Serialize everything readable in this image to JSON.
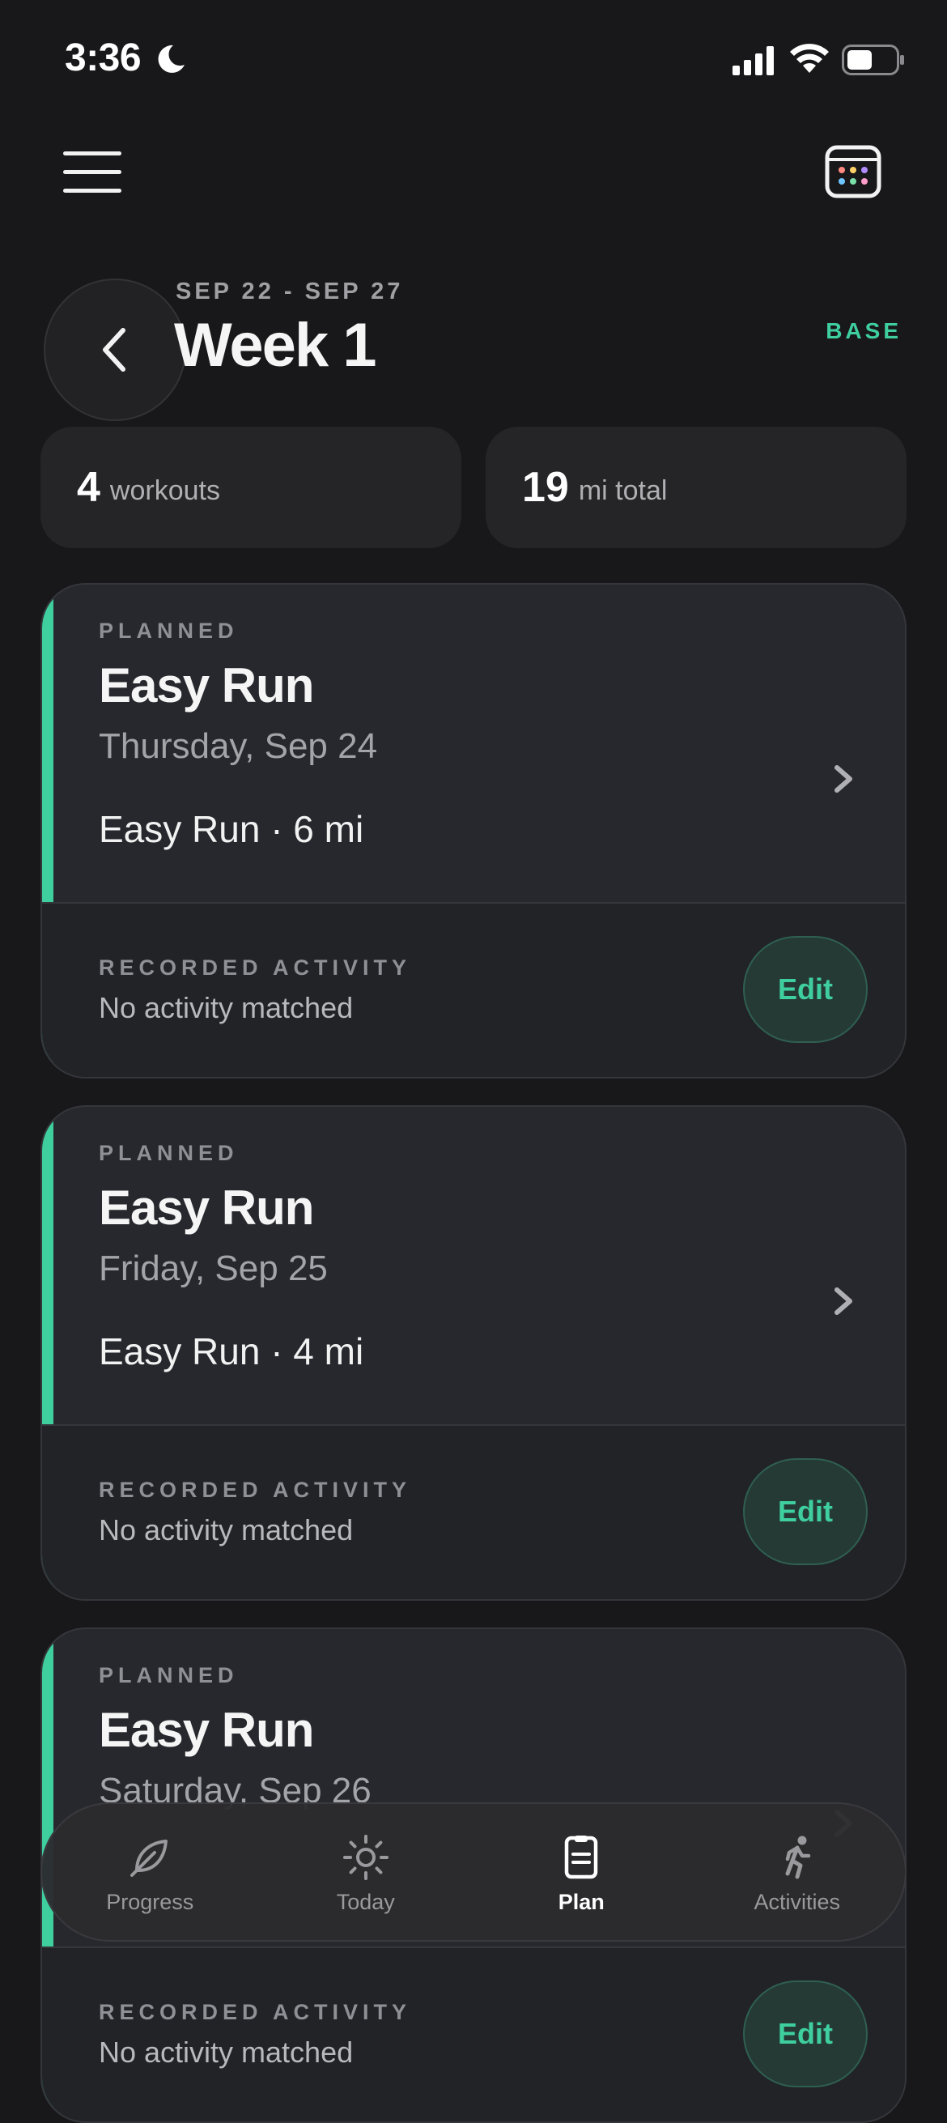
{
  "status_bar": {
    "time": "3:36"
  },
  "week": {
    "range": "SEP 22 - SEP 27",
    "title": "Week 1",
    "phase": "BASE"
  },
  "stats": [
    {
      "value": "4",
      "unit": "workouts"
    },
    {
      "value": "19",
      "unit": "mi total"
    }
  ],
  "workouts": [
    {
      "status_label": "PLANNED",
      "title": "Easy Run",
      "date": "Thursday, Sep 24",
      "detail": "Easy Run · 6 mi",
      "recorded_label": "RECORDED ACTIVITY",
      "recorded_value": "No activity matched",
      "edit_label": "Edit"
    },
    {
      "status_label": "PLANNED",
      "title": "Easy Run",
      "date": "Friday, Sep 25",
      "detail": "Easy Run · 4 mi",
      "recorded_label": "RECORDED ACTIVITY",
      "recorded_value": "No activity matched",
      "edit_label": "Edit"
    },
    {
      "status_label": "PLANNED",
      "title": "Easy Run",
      "date": "Saturday, Sep 26",
      "detail": "",
      "recorded_label": "RECORDED ACTIVITY",
      "recorded_value": "No activity matched",
      "edit_label": "Edit"
    }
  ],
  "tabs": [
    {
      "label": "Progress",
      "icon": "leaf-icon",
      "active": false
    },
    {
      "label": "Today",
      "icon": "sun-icon",
      "active": false
    },
    {
      "label": "Plan",
      "icon": "clipboard-icon",
      "active": true
    },
    {
      "label": "Activities",
      "icon": "runner-icon",
      "active": false
    }
  ],
  "colors": {
    "background": "#18181a",
    "card": "#26282d",
    "accent": "#3fcf9e",
    "muted_text": "#8f9095"
  }
}
